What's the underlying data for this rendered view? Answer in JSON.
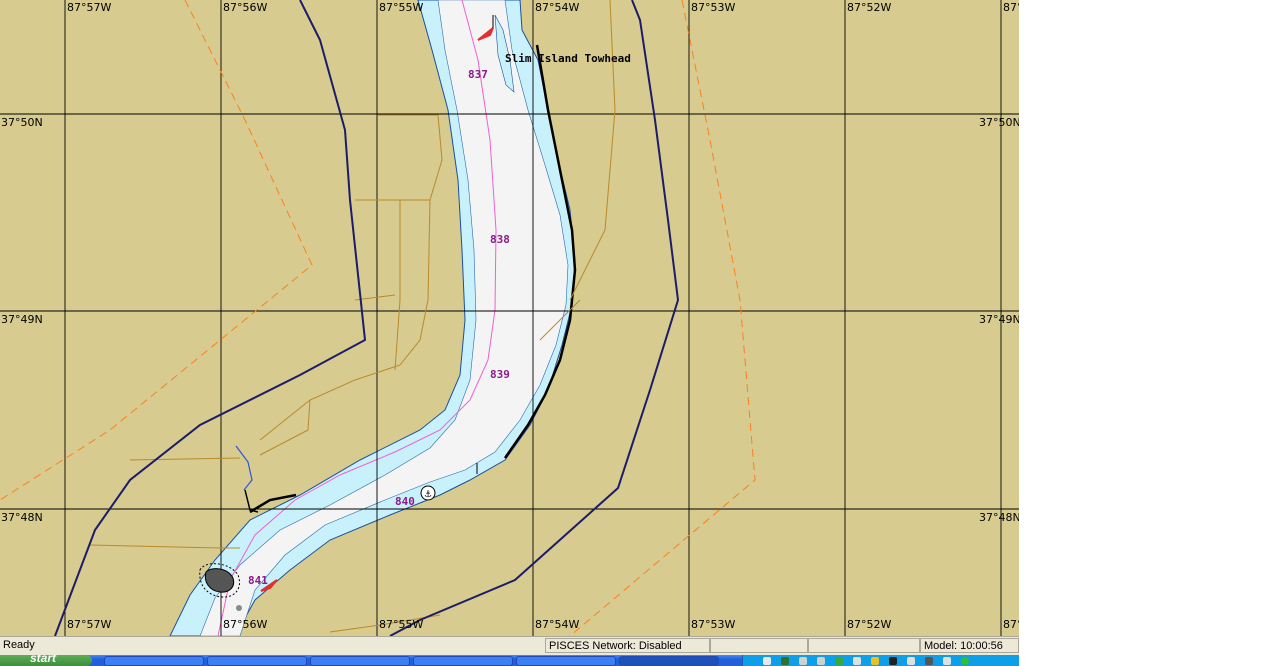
{
  "map": {
    "colors": {
      "land": "#d7cb8f",
      "deep_water": "#f4f4f4",
      "shallow_water": "#c9f1fb",
      "grid": "#000000",
      "sailing_line": "#f060d0",
      "boundary": "#1c1c6a",
      "dashed_boundary": "#ff7f1f",
      "roads": "#b88a2a",
      "mile_marker": "#8b1a8b"
    },
    "longitude_labels": [
      "87°57W",
      "87°56W",
      "87°55W",
      "87°54W",
      "87°53W",
      "87°52W",
      "87°5"
    ],
    "latitude_labels": [
      "37°50N",
      "37°49N",
      "37°48N"
    ],
    "river_miles": [
      "837",
      "838",
      "839",
      "840",
      "841"
    ],
    "place_names": [
      "Slim Island Towhead"
    ]
  },
  "status_bar": {
    "ready": "Ready",
    "network": "PISCES Network: Disabled",
    "model": "Model: 10:00:56"
  },
  "taskbar": {
    "start": "start"
  }
}
